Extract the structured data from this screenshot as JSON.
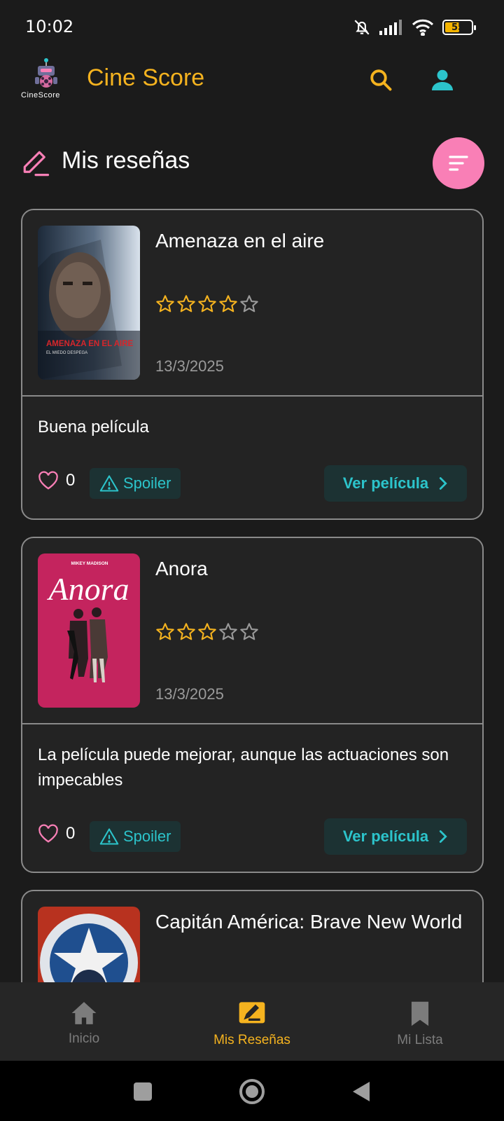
{
  "status_bar": {
    "time": "10:02",
    "battery": "55",
    "battery_level": 0.55,
    "icons": [
      "bell-off-icon",
      "signal-icon",
      "wifi-icon",
      "battery-icon"
    ]
  },
  "header": {
    "logo_text": "CineScore",
    "title": "Cine Score",
    "search_icon": "search-icon",
    "profile_icon": "user-icon"
  },
  "section": {
    "title": "Mis reseñas",
    "icon": "pencil-icon",
    "filter_icon": "sort-icon"
  },
  "reviews": [
    {
      "poster_title": "AMENAZA EN EL AIRE",
      "poster_tagline": "EL MIEDO DESPEGA",
      "title": "Amenaza en el aire",
      "rating": 4,
      "max_rating": 5,
      "date": "13/3/2025",
      "text": "Buena película",
      "likes": "0",
      "spoiler_label": "Spoiler",
      "view_label": "Ver película"
    },
    {
      "poster_title": "Anora",
      "poster_actor": "MIKEY MADISON",
      "title": "Anora",
      "rating": 3,
      "max_rating": 5,
      "date": "13/3/2025",
      "text": "La película puede mejorar, aunque las actuaciones son impecables",
      "likes": "0",
      "spoiler_label": "Spoiler",
      "view_label": "Ver película"
    },
    {
      "title": "Capitán América: Brave New World"
    }
  ],
  "bottom_nav": [
    {
      "label": "Inicio",
      "icon": "home-icon",
      "active": false
    },
    {
      "label": "Mis Reseñas",
      "icon": "review-icon",
      "active": true
    },
    {
      "label": "Mi Lista",
      "icon": "bookmark-icon",
      "active": false
    }
  ],
  "colors": {
    "background": "#1b1b1b",
    "accent": "#f5b31f",
    "teal": "#2cc4cb",
    "pink": "#f97fb6",
    "card": "#232323"
  }
}
